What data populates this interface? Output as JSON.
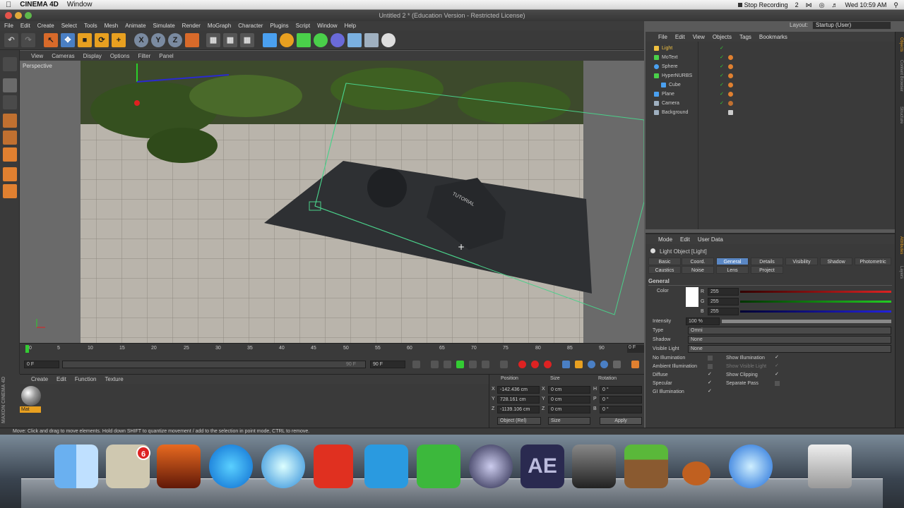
{
  "macbar": {
    "app_name": "CINEMA 4D",
    "menu_window": "Window",
    "stop_recording": "Stop Recording",
    "badge_count": "2",
    "clock": "Wed 10:59 AM"
  },
  "window": {
    "title": "Untitled 2 * (Education Version - Restricted License)"
  },
  "menubar": [
    "File",
    "Edit",
    "Create",
    "Select",
    "Tools",
    "Mesh",
    "Animate",
    "Simulate",
    "Render",
    "MoGraph",
    "Character",
    "Plugins",
    "Script",
    "Window",
    "Help"
  ],
  "layout": {
    "label": "Layout:",
    "value": "Startup (User)"
  },
  "toolbar": {
    "x_label": "X",
    "y_label": "Y",
    "z_label": "Z"
  },
  "viewport": {
    "menu": [
      "View",
      "Cameras",
      "Display",
      "Options",
      "Filter",
      "Panel"
    ],
    "name": "Perspective",
    "box_text": "TUTORIAL"
  },
  "timeline": {
    "ticks": [
      "0",
      "5",
      "10",
      "15",
      "20",
      "25",
      "30",
      "35",
      "40",
      "45",
      "50",
      "55",
      "60",
      "65",
      "70",
      "75",
      "80",
      "85",
      "90"
    ],
    "end_frame": "0 F"
  },
  "playback": {
    "start_field": "0 F",
    "range_end": "90 F",
    "range_end_field": "90 F"
  },
  "material_manager": {
    "menu": [
      "Create",
      "Edit",
      "Function",
      "Texture"
    ],
    "material_name": "Mat"
  },
  "maxon_logo": "MAXON CINEMA 4D",
  "coords": {
    "headers": {
      "position": "Position",
      "size": "Size",
      "rotation": "Rotation"
    },
    "rows": [
      {
        "axis": "X",
        "pos": "-142.436 cm",
        "saxis": "X",
        "size": "0 cm",
        "raxis": "H",
        "rot": "0 °"
      },
      {
        "axis": "Y",
        "pos": "728.161 cm",
        "saxis": "Y",
        "size": "0 cm",
        "raxis": "P",
        "rot": "0 °"
      },
      {
        "axis": "Z",
        "pos": "-1139.106 cm",
        "saxis": "Z",
        "size": "0 cm",
        "raxis": "B",
        "rot": "0 °"
      }
    ],
    "mode_select": "Object (Rel)",
    "size_select": "Size",
    "apply_label": "Apply"
  },
  "status": "Move: Click and drag to move elements. Hold down SHIFT to quantize movement / add to the selection in point mode, CTRL to remove.",
  "object_manager": {
    "menu": [
      "File",
      "Edit",
      "View",
      "Objects",
      "Tags",
      "Bookmarks"
    ],
    "objects": [
      {
        "name": "Light",
        "color": "#f0c040",
        "selected": true
      },
      {
        "name": "MoText",
        "color": "#4ad04a",
        "selected": false
      },
      {
        "name": "Sphere",
        "color": "#4aa0f0",
        "selected": false
      },
      {
        "name": "HyperNURBS",
        "color": "#4ad04a",
        "selected": false
      },
      {
        "name": "Cube",
        "color": "#4aa0f0",
        "selected": false
      },
      {
        "name": "Plane",
        "color": "#4aa0f0",
        "selected": false
      },
      {
        "name": "Camera",
        "color": "#9fb0c0",
        "selected": false
      },
      {
        "name": "Background",
        "color": "#9fb0c0",
        "selected": false
      }
    ]
  },
  "attributes": {
    "menu": [
      "Mode",
      "Edit",
      "User Data"
    ],
    "object_title": "Light Object [Light]",
    "tabs_row1": [
      "Basic",
      "Coord.",
      "General",
      "Details",
      "Visibility",
      "Shadow",
      "Photometric"
    ],
    "tabs_row2": [
      "Caustics",
      "Noise",
      "Lens",
      "Project"
    ],
    "active_tab": "General",
    "section": "General",
    "color_label": "Color",
    "r_label": "R",
    "r_value": "255",
    "g_label": "G",
    "g_value": "255",
    "b_label": "B",
    "b_value": "255",
    "intensity_label": "Intensity",
    "intensity_value": "100 %",
    "type_label": "Type",
    "type_value": "Omni",
    "shadow_label": "Shadow",
    "shadow_value": "None",
    "visible_light_label": "Visible Light",
    "visible_light_value": "None",
    "checks_left": [
      "No Illumination",
      "Ambient Illumination",
      "Diffuse",
      "Specular",
      "GI Illumination"
    ],
    "checks_right": [
      "Show Illumination",
      "Show Visible Light",
      "Show Clipping",
      "Separate Pass"
    ]
  },
  "side_tabs": [
    "Objects",
    "Content Browser",
    "Structure",
    "Attributes",
    "Layers"
  ],
  "dock": {
    "mail_badge": "6",
    "ae_label": "AE"
  }
}
